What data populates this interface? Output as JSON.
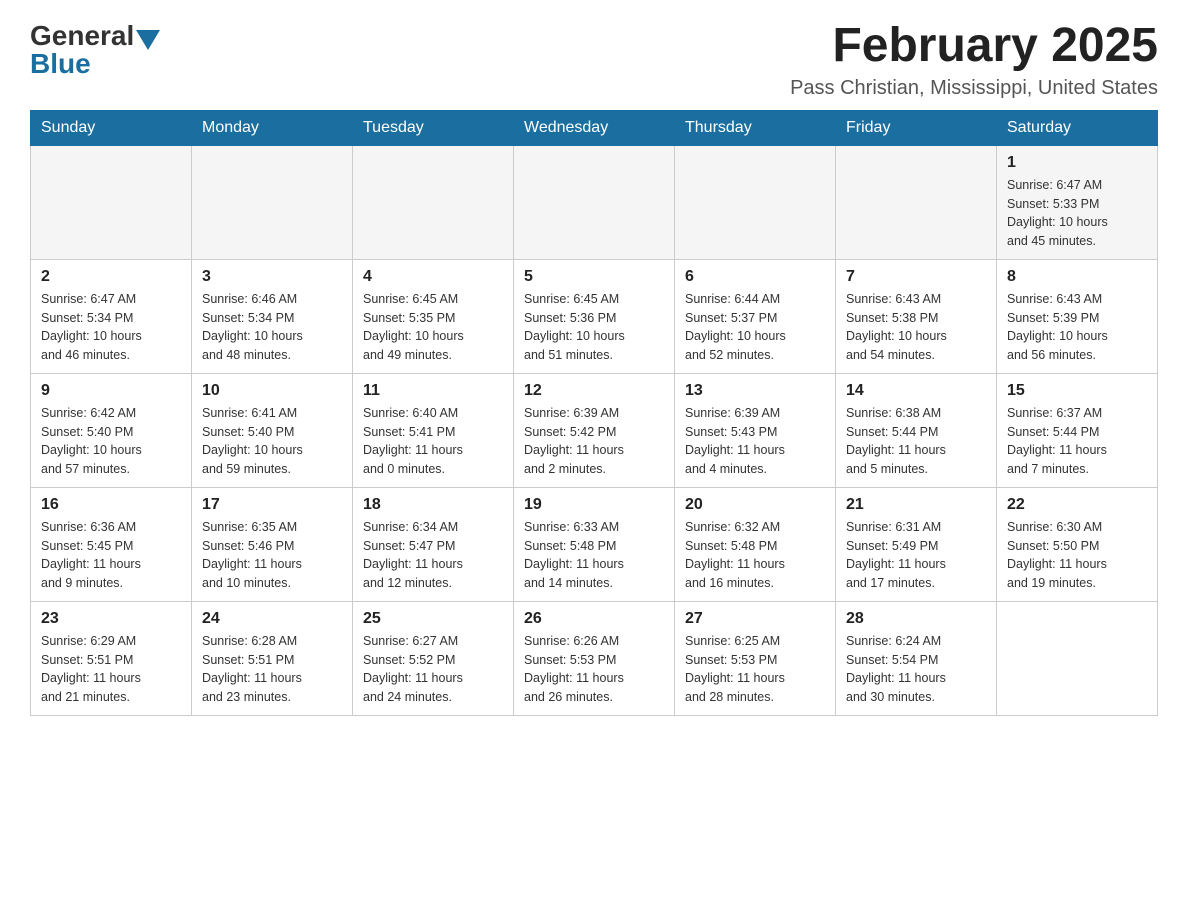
{
  "logo": {
    "general": "General",
    "blue": "Blue"
  },
  "title": "February 2025",
  "location": "Pass Christian, Mississippi, United States",
  "days_of_week": [
    "Sunday",
    "Monday",
    "Tuesday",
    "Wednesday",
    "Thursday",
    "Friday",
    "Saturday"
  ],
  "weeks": [
    [
      {
        "day": "",
        "info": ""
      },
      {
        "day": "",
        "info": ""
      },
      {
        "day": "",
        "info": ""
      },
      {
        "day": "",
        "info": ""
      },
      {
        "day": "",
        "info": ""
      },
      {
        "day": "",
        "info": ""
      },
      {
        "day": "1",
        "info": "Sunrise: 6:47 AM\nSunset: 5:33 PM\nDaylight: 10 hours\nand 45 minutes."
      }
    ],
    [
      {
        "day": "2",
        "info": "Sunrise: 6:47 AM\nSunset: 5:34 PM\nDaylight: 10 hours\nand 46 minutes."
      },
      {
        "day": "3",
        "info": "Sunrise: 6:46 AM\nSunset: 5:34 PM\nDaylight: 10 hours\nand 48 minutes."
      },
      {
        "day": "4",
        "info": "Sunrise: 6:45 AM\nSunset: 5:35 PM\nDaylight: 10 hours\nand 49 minutes."
      },
      {
        "day": "5",
        "info": "Sunrise: 6:45 AM\nSunset: 5:36 PM\nDaylight: 10 hours\nand 51 minutes."
      },
      {
        "day": "6",
        "info": "Sunrise: 6:44 AM\nSunset: 5:37 PM\nDaylight: 10 hours\nand 52 minutes."
      },
      {
        "day": "7",
        "info": "Sunrise: 6:43 AM\nSunset: 5:38 PM\nDaylight: 10 hours\nand 54 minutes."
      },
      {
        "day": "8",
        "info": "Sunrise: 6:43 AM\nSunset: 5:39 PM\nDaylight: 10 hours\nand 56 minutes."
      }
    ],
    [
      {
        "day": "9",
        "info": "Sunrise: 6:42 AM\nSunset: 5:40 PM\nDaylight: 10 hours\nand 57 minutes."
      },
      {
        "day": "10",
        "info": "Sunrise: 6:41 AM\nSunset: 5:40 PM\nDaylight: 10 hours\nand 59 minutes."
      },
      {
        "day": "11",
        "info": "Sunrise: 6:40 AM\nSunset: 5:41 PM\nDaylight: 11 hours\nand 0 minutes."
      },
      {
        "day": "12",
        "info": "Sunrise: 6:39 AM\nSunset: 5:42 PM\nDaylight: 11 hours\nand 2 minutes."
      },
      {
        "day": "13",
        "info": "Sunrise: 6:39 AM\nSunset: 5:43 PM\nDaylight: 11 hours\nand 4 minutes."
      },
      {
        "day": "14",
        "info": "Sunrise: 6:38 AM\nSunset: 5:44 PM\nDaylight: 11 hours\nand 5 minutes."
      },
      {
        "day": "15",
        "info": "Sunrise: 6:37 AM\nSunset: 5:44 PM\nDaylight: 11 hours\nand 7 minutes."
      }
    ],
    [
      {
        "day": "16",
        "info": "Sunrise: 6:36 AM\nSunset: 5:45 PM\nDaylight: 11 hours\nand 9 minutes."
      },
      {
        "day": "17",
        "info": "Sunrise: 6:35 AM\nSunset: 5:46 PM\nDaylight: 11 hours\nand 10 minutes."
      },
      {
        "day": "18",
        "info": "Sunrise: 6:34 AM\nSunset: 5:47 PM\nDaylight: 11 hours\nand 12 minutes."
      },
      {
        "day": "19",
        "info": "Sunrise: 6:33 AM\nSunset: 5:48 PM\nDaylight: 11 hours\nand 14 minutes."
      },
      {
        "day": "20",
        "info": "Sunrise: 6:32 AM\nSunset: 5:48 PM\nDaylight: 11 hours\nand 16 minutes."
      },
      {
        "day": "21",
        "info": "Sunrise: 6:31 AM\nSunset: 5:49 PM\nDaylight: 11 hours\nand 17 minutes."
      },
      {
        "day": "22",
        "info": "Sunrise: 6:30 AM\nSunset: 5:50 PM\nDaylight: 11 hours\nand 19 minutes."
      }
    ],
    [
      {
        "day": "23",
        "info": "Sunrise: 6:29 AM\nSunset: 5:51 PM\nDaylight: 11 hours\nand 21 minutes."
      },
      {
        "day": "24",
        "info": "Sunrise: 6:28 AM\nSunset: 5:51 PM\nDaylight: 11 hours\nand 23 minutes."
      },
      {
        "day": "25",
        "info": "Sunrise: 6:27 AM\nSunset: 5:52 PM\nDaylight: 11 hours\nand 24 minutes."
      },
      {
        "day": "26",
        "info": "Sunrise: 6:26 AM\nSunset: 5:53 PM\nDaylight: 11 hours\nand 26 minutes."
      },
      {
        "day": "27",
        "info": "Sunrise: 6:25 AM\nSunset: 5:53 PM\nDaylight: 11 hours\nand 28 minutes."
      },
      {
        "day": "28",
        "info": "Sunrise: 6:24 AM\nSunset: 5:54 PM\nDaylight: 11 hours\nand 30 minutes."
      },
      {
        "day": "",
        "info": ""
      }
    ]
  ]
}
